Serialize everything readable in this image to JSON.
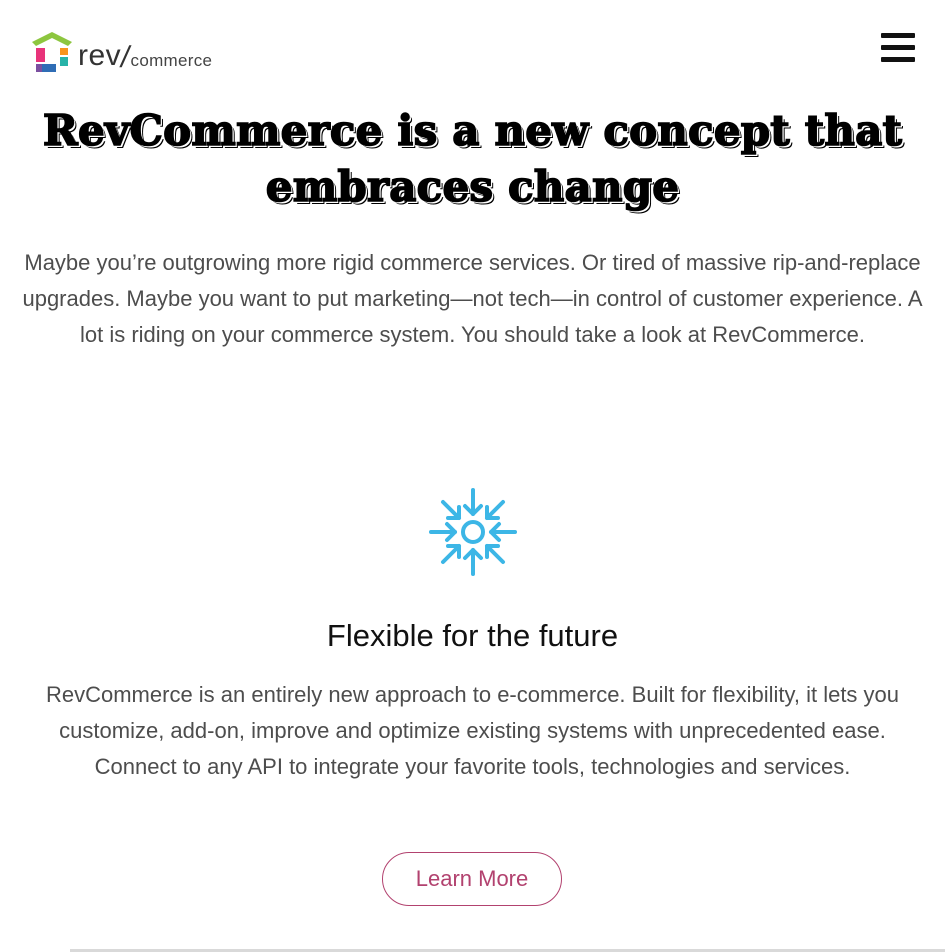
{
  "header": {
    "logo_rev": "rev",
    "logo_slash": "/",
    "logo_commerce": "commerce",
    "menu_icon": "hamburger-menu-icon"
  },
  "hero": {
    "title_line1": "RevCommerce is a new concept that",
    "title_line2": "embraces change",
    "body": "Maybe you’re outgrowing more rigid commerce services. Or tired of massive rip-and-replace upgrades. Maybe you want to put marketing—not tech—in control of customer experience. A lot is riding on your commerce system. You should take a look at RevCommerce."
  },
  "feature": {
    "icon": "converging-arrows-icon",
    "title": "Flexible for the future",
    "body": "RevCommerce is an entirely new approach to e-commerce. Built for flexibility, it lets you customize, add-on, improve and optimize existing systems with unprecedented ease. Connect to any API to integrate your favorite tools, technologies and services.",
    "button_label": "Learn More"
  },
  "colors": {
    "accent": "#b2426f",
    "icon_blue": "#3cb6e6",
    "logo_green": "#8dc63f",
    "logo_pink": "#e8337a",
    "logo_blue": "#2f6db5",
    "text_gray": "#4d4d4d"
  }
}
